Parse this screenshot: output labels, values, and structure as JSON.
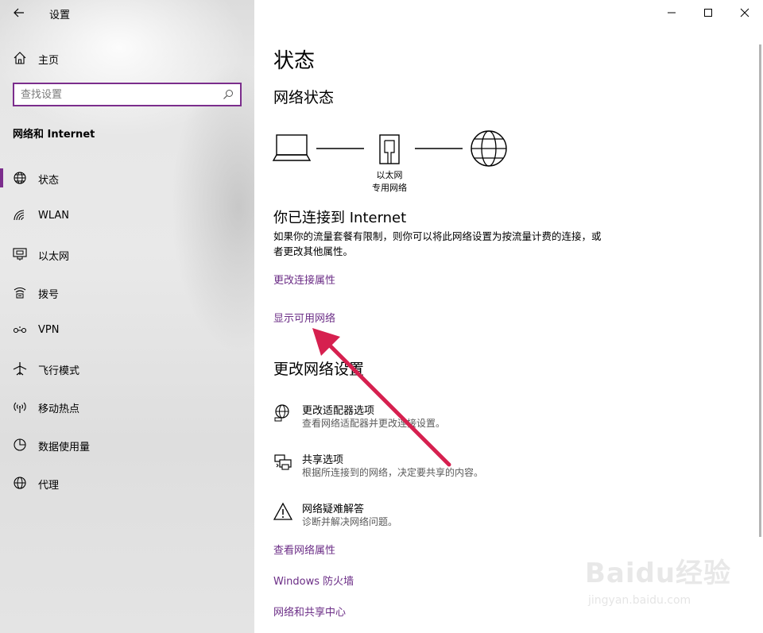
{
  "app": {
    "title": "设置"
  },
  "sidebar": {
    "home_label": "主页",
    "search_placeholder": "查找设置",
    "section_title": "网络和 Internet",
    "items": [
      {
        "label": "状态",
        "icon": "globe-status-icon",
        "active": true
      },
      {
        "label": "WLAN",
        "icon": "wifi-icon",
        "active": false
      },
      {
        "label": "以太网",
        "icon": "ethernet-icon",
        "active": false
      },
      {
        "label": "拨号",
        "icon": "dialup-icon",
        "active": false
      },
      {
        "label": "VPN",
        "icon": "vpn-icon",
        "active": false
      },
      {
        "label": "飞行模式",
        "icon": "airplane-icon",
        "active": false
      },
      {
        "label": "移动热点",
        "icon": "hotspot-icon",
        "active": false
      },
      {
        "label": "数据使用量",
        "icon": "data-usage-icon",
        "active": false
      },
      {
        "label": "代理",
        "icon": "proxy-globe-icon",
        "active": false
      }
    ]
  },
  "main": {
    "page_title": "状态",
    "network_status_heading": "网络状态",
    "diagram": {
      "adapter_line1": "以太网",
      "adapter_line2": "专用网络"
    },
    "connected_title": "你已连接到 Internet",
    "connected_desc": "如果你的流量套餐有限制，则你可以将此网络设置为按流量计费的连接，或者更改其他属性。",
    "link_change_props": "更改连接属性",
    "link_show_networks": "显示可用网络",
    "change_settings_heading": "更改网络设置",
    "options": [
      {
        "title": "更改适配器选项",
        "subtitle": "查看网络适配器并更改连接设置。",
        "icon": "adapter-globe-icon"
      },
      {
        "title": "共享选项",
        "subtitle": "根据所连接到的网络，决定要共享的内容。",
        "icon": "sharing-printer-icon"
      },
      {
        "title": "网络疑难解答",
        "subtitle": "诊断并解决网络问题。",
        "icon": "warning-icon"
      }
    ],
    "link_view_props": "查看网络属性",
    "link_firewall": "Windows 防火墙",
    "link_sharing_center": "网络和共享中心"
  },
  "watermark": {
    "line1": "Baidu经验",
    "line2": "jingyan.baidu.com"
  },
  "colors": {
    "accent": "#7b2d8c",
    "link": "#6b2d86",
    "arrow": "#d6204f"
  }
}
